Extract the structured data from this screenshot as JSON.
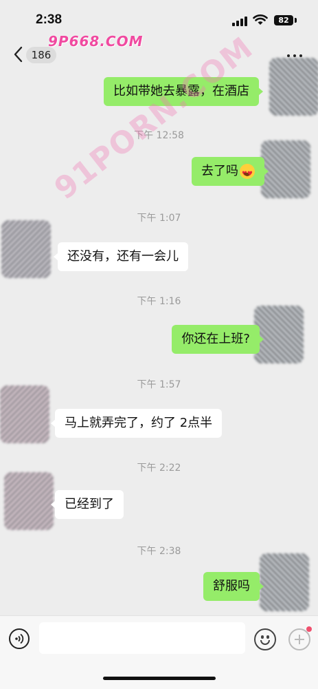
{
  "status_bar": {
    "time": "2:38",
    "battery": "82",
    "icons": [
      "signal-icon",
      "wifi-icon",
      "battery-icon"
    ]
  },
  "watermark": {
    "top": "9P668.COM",
    "diagonal": "91PORN.COM"
  },
  "nav": {
    "unread_count": "186",
    "back_icon": "chevron-left-icon",
    "more_icon": "more-dots-icon"
  },
  "messages": [
    {
      "from": "me",
      "text": "比如带她去暴露，在酒店"
    },
    {
      "type": "time",
      "text": "下午 12:58"
    },
    {
      "from": "me",
      "text": "去了吗",
      "emoji": "heart-eyes-emoji"
    },
    {
      "type": "time",
      "text": "下午 1:07"
    },
    {
      "from": "them",
      "text": "还没有，还有一会儿"
    },
    {
      "type": "time",
      "text": "下午 1:16"
    },
    {
      "from": "me",
      "text": "你还在上班?"
    },
    {
      "type": "time",
      "text": "下午 1:57"
    },
    {
      "from": "them",
      "text": "马上就弄完了，约了 2点半"
    },
    {
      "type": "time",
      "text": "下午 2:22"
    },
    {
      "from": "them",
      "text": "已经到了"
    },
    {
      "type": "time",
      "text": "下午 2:38"
    },
    {
      "from": "me",
      "text": "舒服吗"
    }
  ],
  "input_bar": {
    "placeholder": "",
    "icons": [
      "voice-icon",
      "emoji-icon",
      "plus-icon"
    ]
  },
  "colors": {
    "background": "#ededed",
    "my_bubble": "#95ec69",
    "their_bubble": "#ffffff",
    "timestamp": "#9a9a9a"
  }
}
